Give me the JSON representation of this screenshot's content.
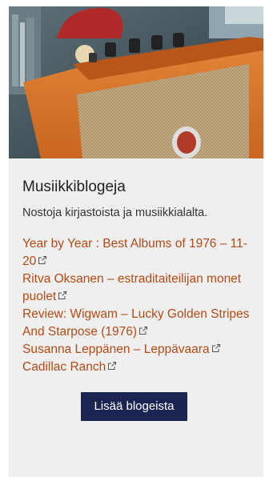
{
  "card": {
    "image_description": "orange-guitar-amplifier-photo",
    "title": "Musiikkiblogeja",
    "subtitle": "Nostoja kirjastoista ja musiikkialalta.",
    "links": [
      {
        "label": "Year by Year : Best Albums of 1976 – 11-20"
      },
      {
        "label": "Ritva Oksanen – estraditaiteilijan monet puolet"
      },
      {
        "label": "Review: Wigwam – Lucky Golden Stripes And Starpose (1976)"
      },
      {
        "label": "Susanna Leppänen – Leppävaara"
      },
      {
        "label": "Cadillac Ranch"
      }
    ],
    "more_button": "Lisää blogeista"
  },
  "colors": {
    "link": "#b44a14",
    "button_bg": "#1c2451",
    "card_bg": "#efefef"
  }
}
